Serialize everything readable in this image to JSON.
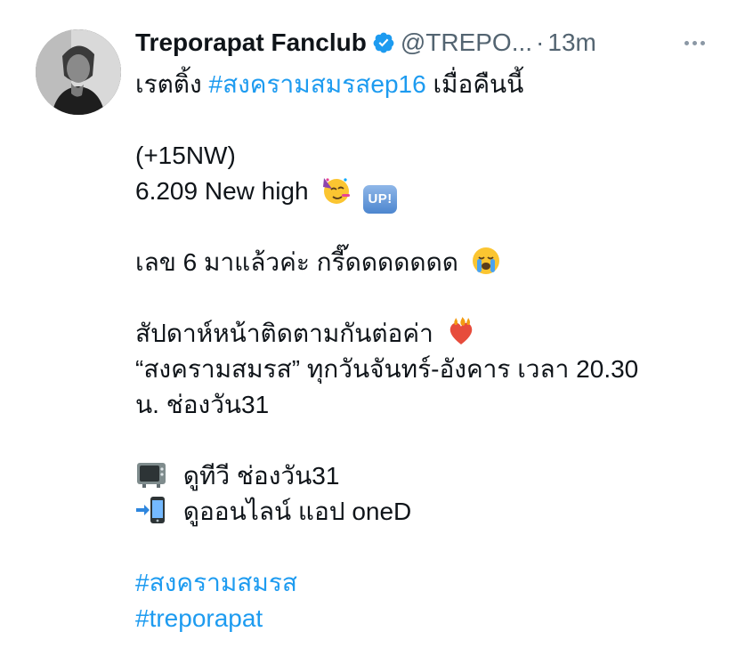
{
  "author": {
    "display_name": "Treporapat Fanclub",
    "handle": "@TREPO...",
    "separator": "·",
    "time": "13m",
    "verified": true
  },
  "tweet": {
    "line1_text": "เรตติ้ง",
    "line1_hashtag": "#สงครามสมรสep16",
    "line1_suffix": "เมื่อคืนนี้",
    "line2": "(+15NW)",
    "line3": "6.209 New high",
    "line3_badge": "UP!",
    "line4": "เลข 6 มาแล้วค่ะ กรี๊ดดดดดดด",
    "line5": "สัปดาห์หน้าติดตามกันต่อค่า",
    "line6": "“สงครามสมรส” ทุกวันจันทร์-อังคาร เวลา 20.30",
    "line7": "น. ช่องวัน31",
    "line8": "ดูทีวี ช่องวัน31",
    "line9": "ดูออนไลน์ แอป oneD",
    "hashtag1": "#สงครามสมรส",
    "hashtag2": "#treporapat"
  },
  "icons": {
    "verified": "verified-badge-icon",
    "more": "more-options-icon",
    "party_face": "partying-face-emoji",
    "up_button": "up-button-emoji",
    "crying_face": "loudly-crying-face-emoji",
    "heart_on_fire": "heart-on-fire-emoji",
    "television": "television-emoji",
    "mobile_arrow": "mobile-phone-with-arrow-emoji"
  },
  "colors": {
    "link": "#1d9bf0",
    "text": "#0f1419",
    "secondary": "#536471",
    "verified": "#1d9bf0"
  }
}
